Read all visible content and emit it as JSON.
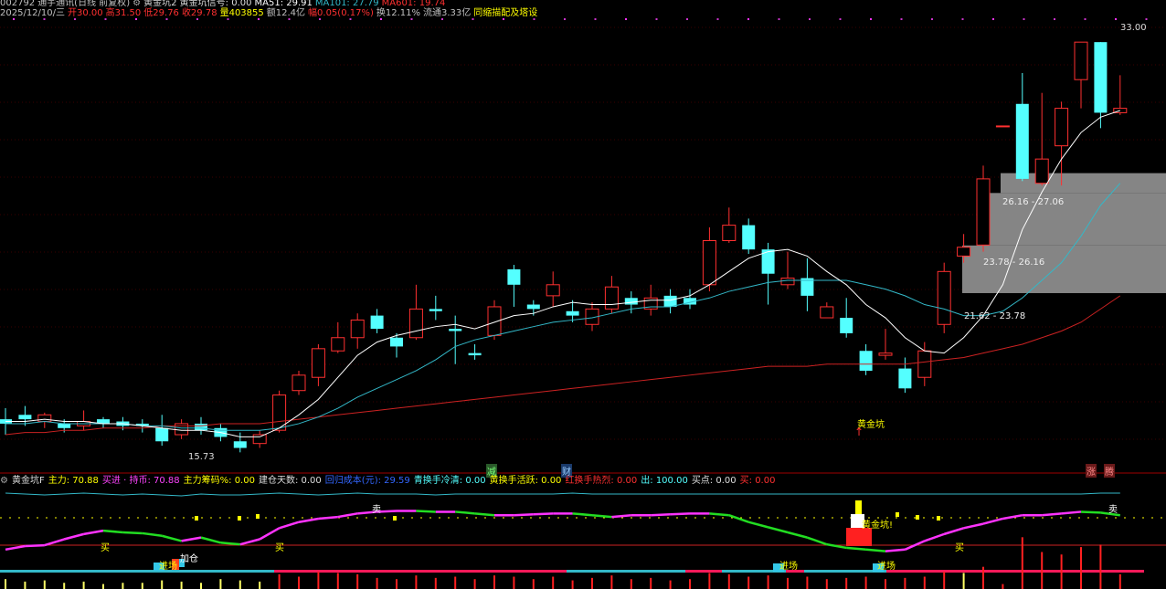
{
  "header": {
    "code": "002792",
    "name_desc": "通宇通讯(日线 前复权)",
    "indicator": "黄金坑2 黄金坑信号: 0.00",
    "ma5_text": "MA51: 29.91",
    "ma10_text": "MA101: 27.79",
    "ma60_text": "MA601: 19.74",
    "date": "2025/12/10/三",
    "open": "开30.00",
    "high": "高31.50",
    "low": "低29.76",
    "close": "收29.78",
    "volume": "量403855",
    "amount": "额12.4亿",
    "change": "幅0.05(0.17%)",
    "turnover": "换12.11%",
    "float_cap": "流通3.33亿",
    "concept": "同缩描配及塔设"
  },
  "price_chart": {
    "high_label": "33.00",
    "low_label": "15.73",
    "chip_zones": [
      "26.16 - 27.06",
      "23.78 - 26.16",
      "21.62 - 23.78"
    ],
    "signal_label": "黄金坑",
    "markers": [
      "减",
      "财",
      "涨",
      "腾"
    ]
  },
  "indicator_header": {
    "name": "黄金坑F",
    "main": "主力: 70.88",
    "in_sell": "买进 · 持币: 70.88",
    "chip": "主力筹码%: 0.00",
    "days": "建仓天数: 0.00",
    "dark_blue": "回归成本(元): 29.59",
    "cold": "青换手冷清: 0.00",
    "active": "黄换手活跃: 0.00",
    "hot": "红换手热烈: 0.00",
    "out": "出: 100.00",
    "buy_point": "买点: 0.00",
    "buy": "买: 0.00"
  },
  "indicator_labels": {
    "buy": "买",
    "sell": "卖",
    "enter": "进场",
    "add": "加仓",
    "golden_pit": "黄金坑!"
  },
  "colors": {
    "up": "#ff3030",
    "down": "#54ffff",
    "ma5": "#ffffff",
    "ma10": "#33b8c8",
    "ma60": "#cc2222",
    "chip": "#8c8c8c"
  },
  "chart_data": {
    "type": "candlestick",
    "candles": [
      [
        15.9,
        15.7,
        16.4,
        15.2
      ],
      [
        16.1,
        15.9,
        16.5,
        15.6
      ],
      [
        15.8,
        16.1,
        16.2,
        15.5
      ],
      [
        15.7,
        15.5,
        15.9,
        15.3
      ],
      [
        15.6,
        15.8,
        16.3,
        15.4
      ],
      [
        15.9,
        15.7,
        16.0,
        15.5
      ],
      [
        15.8,
        15.6,
        16.0,
        15.4
      ],
      [
        15.7,
        15.6,
        15.9,
        15.3
      ],
      [
        15.5,
        14.9,
        16.1,
        14.7
      ],
      [
        15.2,
        15.7,
        15.9,
        15.0
      ],
      [
        15.7,
        15.4,
        16.0,
        15.2
      ],
      [
        15.5,
        15.1,
        15.7,
        14.9
      ],
      [
        14.9,
        14.6,
        15.3,
        14.4
      ],
      [
        14.8,
        15.2,
        15.4,
        14.6
      ],
      [
        15.4,
        17.0,
        17.2,
        15.3
      ],
      [
        17.2,
        17.9,
        18.1,
        17.0
      ],
      [
        17.8,
        19.1,
        19.3,
        17.4
      ],
      [
        19.0,
        19.6,
        20.3,
        18.9
      ],
      [
        19.6,
        20.4,
        20.7,
        19.1
      ],
      [
        20.6,
        20.0,
        20.9,
        19.8
      ],
      [
        19.6,
        19.2,
        19.8,
        18.7
      ],
      [
        19.6,
        20.9,
        22.0,
        19.5
      ],
      [
        20.9,
        20.8,
        21.5,
        20.4
      ],
      [
        20.0,
        19.9,
        20.6,
        18.4
      ],
      [
        18.9,
        18.8,
        19.3,
        18.6
      ],
      [
        19.7,
        21.0,
        21.3,
        19.5
      ],
      [
        22.7,
        22.0,
        22.9,
        21.0
      ],
      [
        21.1,
        20.9,
        21.3,
        20.6
      ],
      [
        21.5,
        22.0,
        22.6,
        21.0
      ],
      [
        20.8,
        20.6,
        21.3,
        20.3
      ],
      [
        20.2,
        20.9,
        21.2,
        19.9
      ],
      [
        20.9,
        21.9,
        22.4,
        20.7
      ],
      [
        21.4,
        21.1,
        21.7,
        20.7
      ],
      [
        20.9,
        21.4,
        22.0,
        20.6
      ],
      [
        21.5,
        21.0,
        21.8,
        20.7
      ],
      [
        21.4,
        21.1,
        21.8,
        20.9
      ],
      [
        22.0,
        24.0,
        24.6,
        21.7
      ],
      [
        24.0,
        24.7,
        25.5,
        23.9
      ],
      [
        24.7,
        23.6,
        25.0,
        23.4
      ],
      [
        23.6,
        22.5,
        23.9,
        21.1
      ],
      [
        22.0,
        22.3,
        23.5,
        21.8
      ],
      [
        22.3,
        21.5,
        23.2,
        20.8
      ],
      [
        20.5,
        21.0,
        21.2,
        20.5
      ],
      [
        20.5,
        19.8,
        21.4,
        19.6
      ],
      [
        19.0,
        18.1,
        19.3,
        17.9
      ],
      [
        18.8,
        18.9,
        20.0,
        18.6
      ],
      [
        18.2,
        17.3,
        18.7,
        17.1
      ],
      [
        17.8,
        19.0,
        19.4,
        17.4
      ],
      [
        20.2,
        22.6,
        23.0,
        19.8
      ],
      [
        23.3,
        23.7,
        24.3,
        23.0
      ],
      [
        23.8,
        26.8,
        27.4,
        23.5
      ],
      [
        29.2,
        29.2,
        29.2,
        29.2
      ],
      [
        30.2,
        26.8,
        31.6,
        26.7
      ],
      [
        26.6,
        27.7,
        30.7,
        26.5
      ],
      [
        28.3,
        30.0,
        30.3,
        26.5
      ],
      [
        31.3,
        33.0,
        33.0,
        30.0
      ],
      [
        33.0,
        29.8,
        33.0,
        29.1
      ],
      [
        29.8,
        30.0,
        31.5,
        29.7
      ]
    ],
    "ma5": [
      15.8,
      15.8,
      15.9,
      15.8,
      15.8,
      15.7,
      15.7,
      15.6,
      15.5,
      15.4,
      15.4,
      15.3,
      15.1,
      15.1,
      15.5,
      16.1,
      16.8,
      17.8,
      18.8,
      19.4,
      19.7,
      19.9,
      20.1,
      20.2,
      20.0,
      20.3,
      20.6,
      20.7,
      21.0,
      21.2,
      21.1,
      21.1,
      21.2,
      21.3,
      21.3,
      21.5,
      22.0,
      22.6,
      23.2,
      23.5,
      23.6,
      23.3,
      22.6,
      22.0,
      21.1,
      20.5,
      19.6,
      19.0,
      18.9,
      19.6,
      20.6,
      22.0,
      24.5,
      26.2,
      27.7,
      28.9,
      29.6,
      29.9
    ],
    "ma10": [
      15.7,
      15.7,
      15.8,
      15.7,
      15.7,
      15.7,
      15.7,
      15.6,
      15.6,
      15.5,
      15.5,
      15.4,
      15.4,
      15.4,
      15.5,
      15.7,
      16.0,
      16.4,
      16.9,
      17.3,
      17.7,
      18.1,
      18.6,
      19.2,
      19.5,
      19.7,
      19.9,
      20.1,
      20.3,
      20.4,
      20.5,
      20.7,
      20.9,
      21.0,
      21.0,
      21.2,
      21.4,
      21.7,
      21.9,
      22.1,
      22.2,
      22.2,
      22.2,
      22.2,
      22.0,
      21.8,
      21.5,
      21.1,
      20.9,
      20.6,
      20.6,
      20.8,
      21.4,
      22.2,
      23.0,
      24.2,
      25.6,
      26.6
    ],
    "ma60": [
      15.2,
      15.3,
      15.3,
      15.4,
      15.4,
      15.5,
      15.5,
      15.5,
      15.6,
      15.6,
      15.6,
      15.7,
      15.7,
      15.7,
      15.8,
      15.9,
      16.0,
      16.1,
      16.2,
      16.3,
      16.4,
      16.5,
      16.6,
      16.7,
      16.8,
      16.9,
      17.0,
      17.1,
      17.2,
      17.3,
      17.4,
      17.5,
      17.6,
      17.7,
      17.8,
      17.9,
      18.0,
      18.1,
      18.2,
      18.3,
      18.3,
      18.3,
      18.4,
      18.4,
      18.4,
      18.4,
      18.4,
      18.5,
      18.6,
      18.7,
      18.9,
      19.1,
      19.3,
      19.6,
      19.9,
      20.3,
      20.9,
      21.5
    ],
    "ylim": [
      14.0,
      34.0
    ]
  },
  "indicator_data": {
    "main_line": [
      30,
      34,
      35,
      42,
      48,
      52,
      50,
      49,
      46,
      40,
      44,
      38,
      36,
      42,
      55,
      62,
      66,
      68,
      72,
      74,
      75,
      75,
      74,
      74,
      72,
      70,
      70,
      71,
      72,
      72,
      70,
      68,
      70,
      70,
      71,
      72,
      72,
      70,
      62,
      56,
      50,
      44,
      36,
      32,
      30,
      28,
      30,
      40,
      48,
      55,
      60,
      66,
      70,
      70,
      72,
      74,
      73,
      70
    ],
    "volumes": [
      8,
      6,
      7,
      5,
      6,
      4,
      5,
      5,
      7,
      6,
      5,
      8,
      7,
      6,
      12,
      10,
      14,
      13,
      12,
      9,
      8,
      11,
      9,
      10,
      8,
      11,
      10,
      8,
      10,
      7,
      9,
      11,
      8,
      9,
      7,
      8,
      13,
      12,
      10,
      11,
      9,
      10,
      8,
      9,
      10,
      8,
      9,
      10,
      14,
      13,
      18,
      4,
      42,
      30,
      28,
      34,
      36,
      12
    ]
  }
}
